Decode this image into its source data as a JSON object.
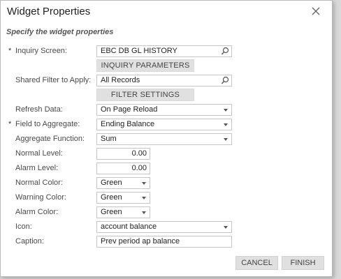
{
  "dialog": {
    "title": "Widget Properties",
    "subtitle": "Specify the widget properties"
  },
  "fields": {
    "inquiry_screen": {
      "required_mark": "*",
      "label": "Inquiry Screen:",
      "value": "EBC DB GL HISTORY",
      "icon": "search-icon"
    },
    "inquiry_parameters_button": "INQUIRY PARAMETERS",
    "shared_filter": {
      "label": "Shared Filter to Apply:",
      "value": "All Records",
      "icon": "search-icon"
    },
    "filter_settings_button": "FILTER SETTINGS",
    "refresh_data": {
      "label": "Refresh Data:",
      "value": "On Page Reload"
    },
    "field_to_aggregate": {
      "required_mark": "*",
      "label": "Field to Aggregate:",
      "value": "Ending Balance"
    },
    "aggregate_function": {
      "label": "Aggregate Function:",
      "value": "Sum"
    },
    "normal_level": {
      "label": "Normal Level:",
      "value": "0.00"
    },
    "alarm_level": {
      "label": "Alarm Level:",
      "value": "0.00"
    },
    "normal_color": {
      "label": "Normal Color:",
      "value": "Green"
    },
    "warning_color": {
      "label": "Warning Color:",
      "value": "Green"
    },
    "alarm_color": {
      "label": "Alarm Color:",
      "value": "Green"
    },
    "icon": {
      "label": "Icon:",
      "value": "account balance"
    },
    "caption": {
      "label": "Caption:",
      "value": "Prev period ap balance"
    }
  },
  "footer": {
    "cancel_label": "CANCEL",
    "finish_label": "FINISH"
  },
  "colors": {
    "button_bg": "#e0e0e0",
    "field_border": "#c6c6c6"
  }
}
